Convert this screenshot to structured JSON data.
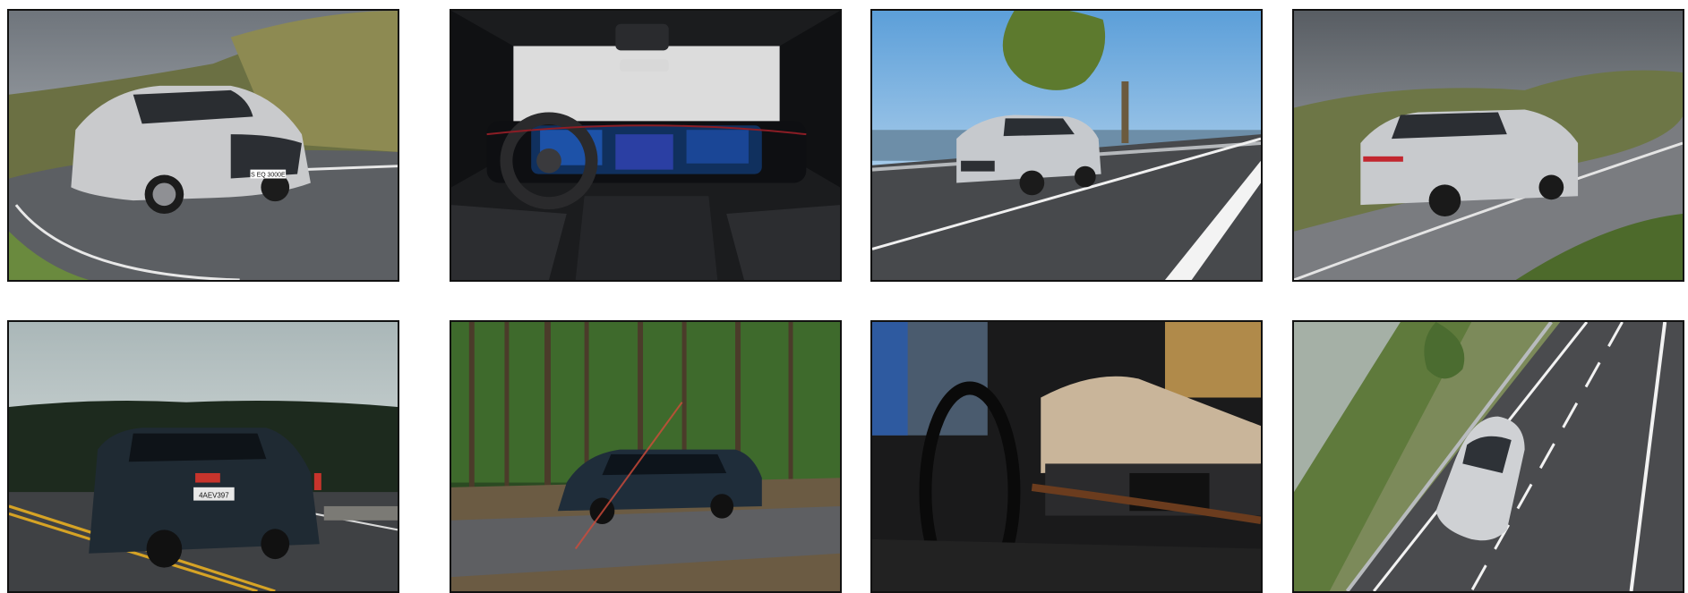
{
  "gallery": {
    "images": [
      {
        "label": "silver-suv-curve-road-front",
        "plate": "S EQ 3000E"
      },
      {
        "label": "suv-interior-dashboard"
      },
      {
        "label": "silver-suv-coastal-road"
      },
      {
        "label": "silver-suv-hill-road-rear"
      },
      {
        "label": "dark-wagon-rear-road",
        "plate": "4AEV397"
      },
      {
        "label": "dark-wagon-forest"
      },
      {
        "label": "classic-interior-dashboard"
      },
      {
        "label": "silver-suv-aerial-highway"
      }
    ]
  },
  "colors": {
    "border": "#111111",
    "silver_car": "#c9cacc",
    "dark_wagon": "#1f2a33"
  }
}
